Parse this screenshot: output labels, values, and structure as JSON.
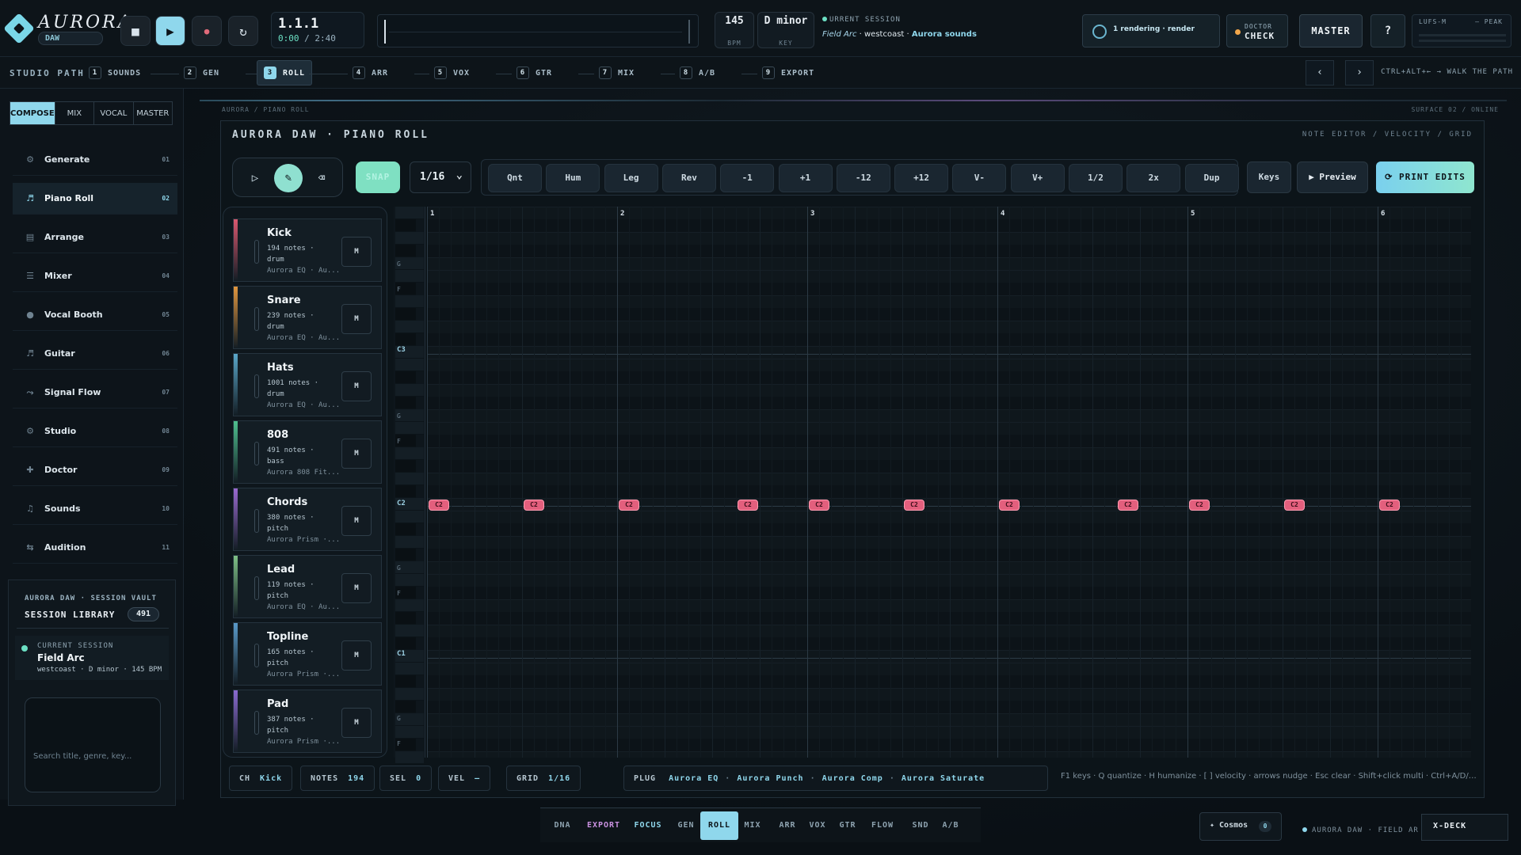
{
  "app": {
    "name": "AURORA",
    "badge": "DAW"
  },
  "transport": {
    "position": "1.1.1",
    "time_current": "0:00",
    "time_sep": "/",
    "time_total": "2:40"
  },
  "bpm": {
    "value": "145",
    "label": "BPM"
  },
  "key": {
    "value": "D minor",
    "label": "KEY"
  },
  "current_session": {
    "label": "URRENT SESSION",
    "name": "Field Arc",
    "sep1": "·",
    "genre": "westcoast",
    "sep2": "·",
    "sounds": "Aurora sounds"
  },
  "render": {
    "label": "1 rendering · render"
  },
  "doctor": {
    "top": "DOCTOR",
    "bottom": "CHECK"
  },
  "master_label": "MASTER",
  "help_label": "?",
  "meter": {
    "lufs": "LUFS-M",
    "peak": "— PEAK"
  },
  "studio_path": {
    "title": "STUDIO PATH",
    "steps": [
      {
        "n": "1",
        "label": "SOUNDS"
      },
      {
        "n": "2",
        "label": "GEN"
      },
      {
        "n": "3",
        "label": "ROLL"
      },
      {
        "n": "4",
        "label": "ARR"
      },
      {
        "n": "5",
        "label": "VOX"
      },
      {
        "n": "6",
        "label": "GTR"
      },
      {
        "n": "7",
        "label": "MIX"
      },
      {
        "n": "8",
        "label": "A/B"
      },
      {
        "n": "9",
        "label": "EXPORT"
      }
    ],
    "prev": "‹",
    "next": "›",
    "hint": "CTRL+ALT+← → WALK THE PATH"
  },
  "sidebar": {
    "modes": [
      "COMPOSE",
      "MIX",
      "VOCAL",
      "MASTER"
    ],
    "items": [
      {
        "icon": "⚙",
        "label": "Generate",
        "num": "01"
      },
      {
        "icon": "♬",
        "label": "Piano Roll",
        "num": "02"
      },
      {
        "icon": "▤",
        "label": "Arrange",
        "num": "03"
      },
      {
        "icon": "☰",
        "label": "Mixer",
        "num": "04"
      },
      {
        "icon": "●",
        "label": "Vocal Booth",
        "num": "05"
      },
      {
        "icon": "♬",
        "label": "Guitar",
        "num": "06"
      },
      {
        "icon": "⤳",
        "label": "Signal Flow",
        "num": "07"
      },
      {
        "icon": "⚙",
        "label": "Studio",
        "num": "08"
      },
      {
        "icon": "✚",
        "label": "Doctor",
        "num": "09"
      },
      {
        "icon": "♫",
        "label": "Sounds",
        "num": "10"
      },
      {
        "icon": "⇆",
        "label": "Audition",
        "num": "11"
      }
    ],
    "vault": {
      "kicker": "AURORA DAW · SESSION VAULT",
      "title": "SESSION LIBRARY",
      "count": "491",
      "current_label": "CURRENT SESSION",
      "current_name": "Field Arc",
      "current_meta": "westcoast · D minor · 145 BPM",
      "search_placeholder": "Search title, genre, key..."
    }
  },
  "main": {
    "crumb": "AURORA / PIANO ROLL",
    "surface": "SURFACE 02 / ONLINE",
    "title": "AURORA DAW · PIANO ROLL",
    "tags": "NOTE EDITOR / VELOCITY / GRID",
    "snap": "SNAP",
    "grid_value": "1/16",
    "ops": [
      "Qnt",
      "Hum",
      "Leg",
      "Rev",
      "-1",
      "+1",
      "-12",
      "+12",
      "V-",
      "V+",
      "1/2",
      "2x",
      "Dup"
    ],
    "keys": "Keys",
    "preview": "▶ Preview",
    "print": "⟳ PRINT EDITS",
    "tracks": [
      {
        "name": "Kick",
        "notes": "194 notes ·",
        "type": "drum",
        "fx": "Aurora EQ · Au...",
        "color": "#d9586f",
        "mute": "M"
      },
      {
        "name": "Snare",
        "notes": "239 notes ·",
        "type": "drum",
        "fx": "Aurora EQ · Au...",
        "color": "#e0963f",
        "mute": "M"
      },
      {
        "name": "Hats",
        "notes": "1001 notes ·",
        "type": "drum",
        "fx": "Aurora EQ · Au...",
        "color": "#5aa7c9",
        "mute": "M"
      },
      {
        "name": "808",
        "notes": "491 notes ·",
        "type": "bass",
        "fx": "Aurora 808 Fit...",
        "color": "#4fbf8f",
        "mute": "M"
      },
      {
        "name": "Chords",
        "notes": "380 notes ·",
        "type": "pitch",
        "fx": "Aurora Prism ·...",
        "color": "#9a6ad0",
        "mute": "M"
      },
      {
        "name": "Lead",
        "notes": "119 notes ·",
        "type": "pitch",
        "fx": "Aurora EQ · Au...",
        "color": "#7fbf86",
        "mute": "M"
      },
      {
        "name": "Topline",
        "notes": "165 notes ·",
        "type": "pitch",
        "fx": "Aurora Prism ·...",
        "color": "#5a9ac9",
        "mute": "M"
      },
      {
        "name": "Pad",
        "notes": "387 notes ·",
        "type": "pitch",
        "fx": "Aurora Prism ·...",
        "color": "#8a6ad0",
        "mute": "M"
      }
    ],
    "key_labels": [
      "G",
      "F",
      "C3",
      "G",
      "F",
      "C2",
      "G",
      "F",
      "C1",
      "G",
      "F"
    ],
    "bars": [
      "1",
      "2",
      "3",
      "4",
      "5",
      "6"
    ],
    "note_label": "C2",
    "notes_on_c2": [
      1.0,
      1.5,
      2.0,
      2.625,
      3.0,
      3.5,
      4.0,
      4.625,
      5.0,
      5.5,
      6.0
    ],
    "status": {
      "ch_label": "CH",
      "ch_value": "Kick",
      "notes_label": "NOTES",
      "notes_value": "194",
      "sel_label": "SEL",
      "sel_value": "0",
      "vel_label": "VEL",
      "vel_value": "—",
      "grid_label": "GRID",
      "grid_value": "1/16",
      "plug_label": "PLUG",
      "plugs": [
        "Aurora EQ",
        "Aurora Punch",
        "Aurora Comp",
        "Aurora Saturate"
      ],
      "shortcuts": "F1 keys · Q quantize · H humanize · [ ] velocity · arrows nudge · Esc clear · Shift+click multi · Ctrl+A/D/C/..."
    }
  },
  "dock": {
    "items": [
      "DNA",
      "EXPORT",
      "FOCUS",
      "GEN",
      "ROLL",
      "MIX",
      "ARR",
      "VOX",
      "GTR",
      "FLOW",
      "SND",
      "A/B"
    ],
    "cosmos": "✦ Cosmos",
    "cosmos_count": "0",
    "session": "AURORA DAW · FIELD AR",
    "xdeck": "X-DECK"
  }
}
